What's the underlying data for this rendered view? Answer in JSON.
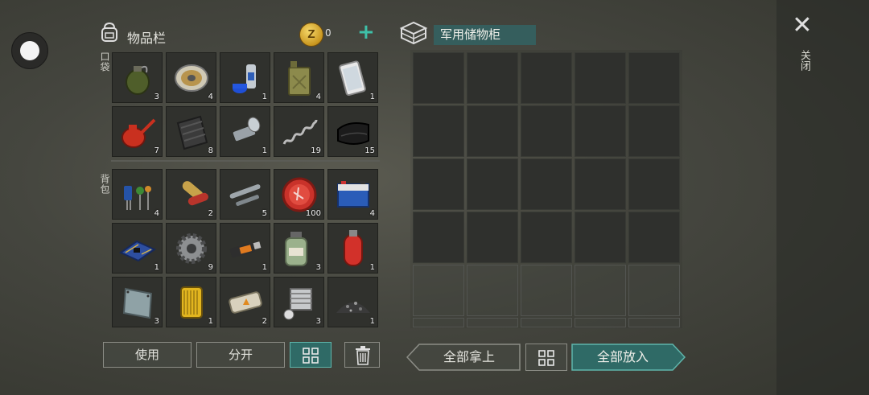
{
  "inventory": {
    "title": "物品栏",
    "coins": "0",
    "pocket_label": "口袋",
    "backpack_label": "背包",
    "pocket_items": [
      {
        "name": "grenade",
        "count": "3"
      },
      {
        "name": "wire-spool",
        "count": "4"
      },
      {
        "name": "spray-can",
        "count": "1"
      },
      {
        "name": "jerrycan",
        "count": "4"
      },
      {
        "name": "smartphone",
        "count": "1"
      },
      {
        "name": "oil-can",
        "count": "7"
      },
      {
        "name": "metal-sheet-roll",
        "count": "8"
      },
      {
        "name": "flashlight",
        "count": "1"
      },
      {
        "name": "spring",
        "count": "19"
      },
      {
        "name": "leather",
        "count": "15"
      }
    ],
    "backpack_items": [
      {
        "name": "electronic-components",
        "count": "4"
      },
      {
        "name": "pills",
        "count": "2"
      },
      {
        "name": "pipes",
        "count": "5"
      },
      {
        "name": "bottle-cap",
        "count": "100"
      },
      {
        "name": "car-battery",
        "count": "4"
      },
      {
        "name": "circuit-board",
        "count": "1"
      },
      {
        "name": "gear",
        "count": "9"
      },
      {
        "name": "usb-drive",
        "count": "1"
      },
      {
        "name": "chemical-jar",
        "count": "3"
      },
      {
        "name": "gas-cylinder",
        "count": "1"
      },
      {
        "name": "metal-plate",
        "count": "3"
      },
      {
        "name": "oil-filter",
        "count": "1"
      },
      {
        "name": "explosive-bar",
        "count": "2"
      },
      {
        "name": "engine-cylinder",
        "count": "3"
      },
      {
        "name": "gravel",
        "count": "1"
      }
    ],
    "buttons": {
      "use": "使用",
      "split": "分开"
    }
  },
  "container": {
    "title": "军用储物柜",
    "buttons": {
      "take_all": "全部拿上",
      "put_all": "全部放入"
    }
  },
  "close_label": "关闭",
  "colors": {
    "accent": "#3ec0a8",
    "teal_button": "#2f6a66",
    "slot": "#30312d"
  }
}
